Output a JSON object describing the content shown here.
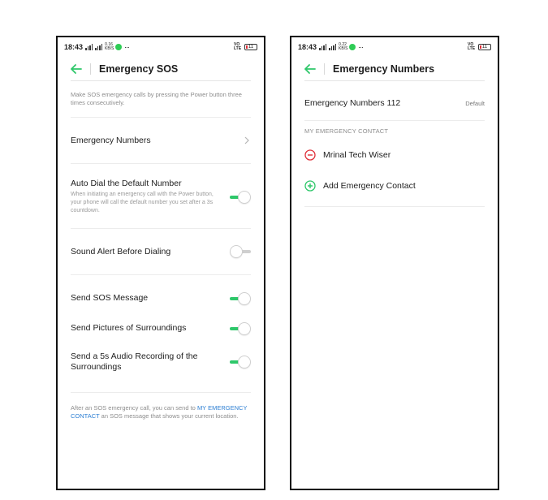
{
  "colors": {
    "accent": "#2ec76a",
    "link": "#2d7fd3",
    "danger": "#e0303a"
  },
  "status_bar": {
    "time": "18:43",
    "left_speed_top": "0.16",
    "left_speed_bottom": "KB/S",
    "right_speed_top": "0.22",
    "right_speed_bottom": "KB/S",
    "volte_top": "VO",
    "volte_bottom": "LTE",
    "battery": "11",
    "dots": "···"
  },
  "left_screen": {
    "title": "Emergency SOS",
    "description": "Make SOS emergency calls by pressing the Power button three times consecutively.",
    "emergency_numbers_label": "Emergency Numbers",
    "auto_dial": {
      "title": "Auto Dial the Default Number",
      "subtitle": "When initiating an emergency call with the Power button, your phone will call the default number you set after a 3s countdown.",
      "enabled": true
    },
    "sound_alert": {
      "title": "Sound Alert Before Dialing",
      "enabled": false
    },
    "send_sos_message": {
      "title": "Send SOS Message",
      "enabled": true
    },
    "send_pictures": {
      "title": "Send Pictures of Surroundings",
      "enabled": true
    },
    "send_audio": {
      "title": "Send a 5s Audio Recording of the Surroundings",
      "enabled": true
    },
    "footer": {
      "before": "After an SOS emergency call, you can send to",
      "link": "MY EMERGENCY CONTACT",
      "after": "an SOS message that shows your current location."
    }
  },
  "right_screen": {
    "title": "Emergency Numbers",
    "number_label": "Emergency Numbers 112",
    "default_badge": "Default",
    "contacts_caption": "MY EMERGENCY CONTACT",
    "contact_name": "Mrinal Tech Wiser",
    "add_contact_label": "Add Emergency Contact"
  }
}
